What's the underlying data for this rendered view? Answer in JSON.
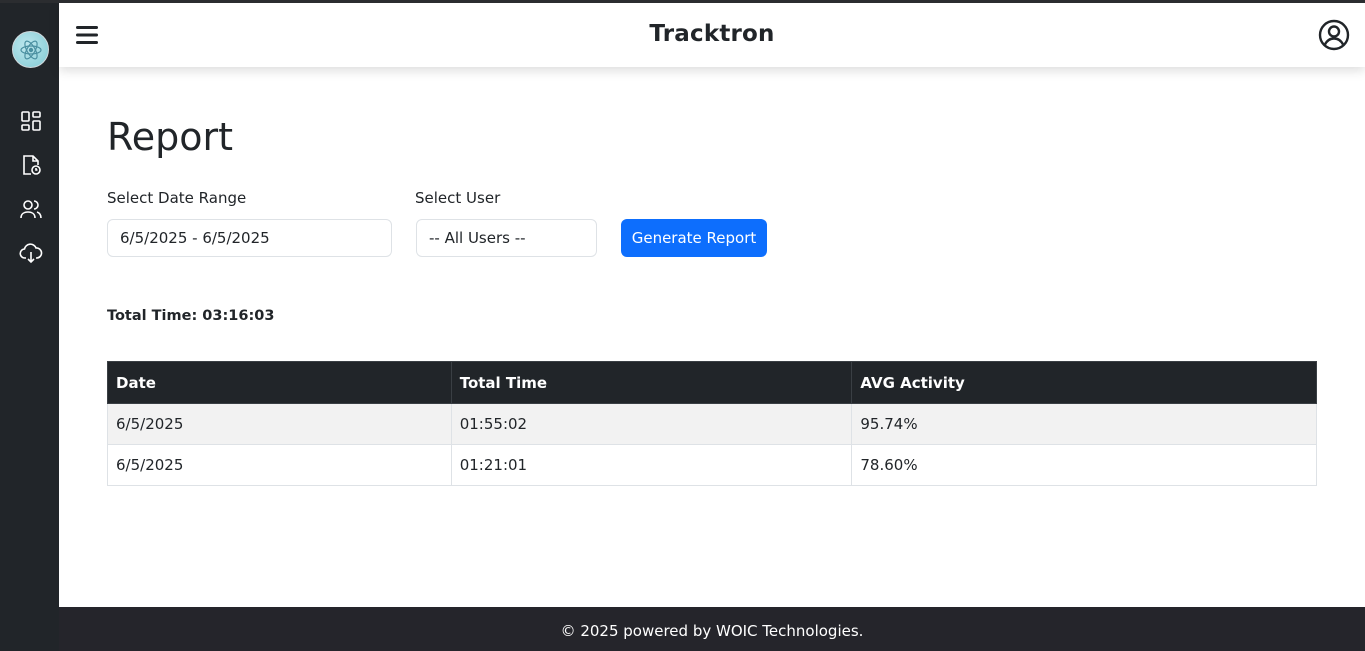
{
  "app": {
    "title": "Tracktron"
  },
  "colors": {
    "sidebar_bg": "#212529",
    "primary": "#0d6efd",
    "footer_bg": "#25252b"
  },
  "sidebar": {
    "items": [
      {
        "icon": "dashboard-icon"
      },
      {
        "icon": "file-clock-icon"
      },
      {
        "icon": "users-icon"
      },
      {
        "icon": "cloud-download-icon"
      }
    ]
  },
  "main": {
    "title": "Report",
    "date_range": {
      "label": "Select Date Range",
      "value": "6/5/2025 - 6/5/2025"
    },
    "user_select": {
      "label": "Select User",
      "value": "-- All Users --"
    },
    "generate_button": "Generate Report",
    "total_time": "Total Time: 03:16:03",
    "table": {
      "headers": [
        "Date",
        "Total Time",
        "AVG Activity"
      ],
      "rows": [
        [
          "6/5/2025",
          "01:55:02",
          "95.74%"
        ],
        [
          "6/5/2025",
          "01:21:01",
          "78.60%"
        ]
      ]
    }
  },
  "footer": {
    "text": "© 2025 powered by WOIC Technologies."
  }
}
